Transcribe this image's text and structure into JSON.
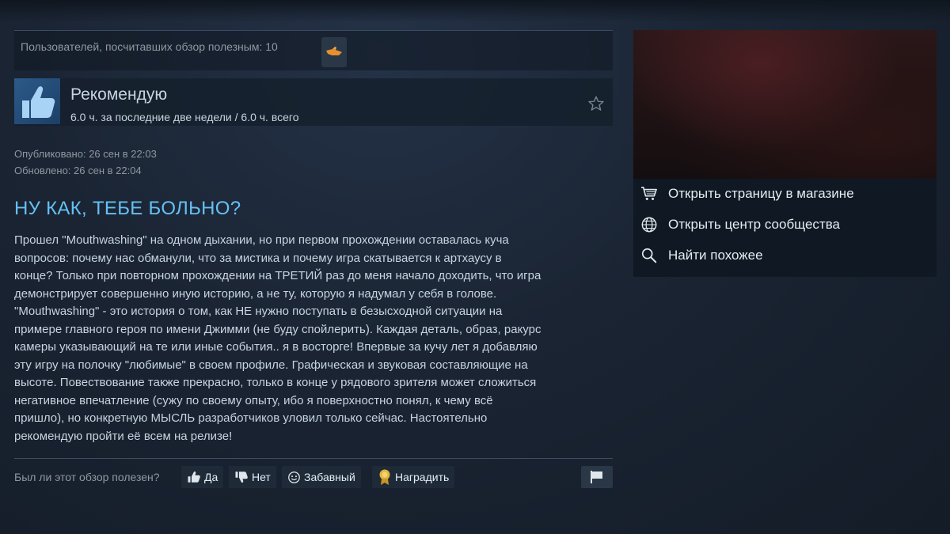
{
  "helpful": {
    "text": "Пользователей, посчитавших обзор полезным: 10"
  },
  "recommendation": {
    "label": "Рекомендую",
    "hours": "6.0 ч. за последние две недели / 6.0 ч. всего"
  },
  "dates": {
    "published": "Опубликовано: 26 сен в 22:03",
    "updated": "Обновлено: 26 сен в 22:04"
  },
  "review": {
    "title": "НУ КАК, ТЕБЕ БОЛЬНО?",
    "lines": [
      "Прошел \"Mouthwashing\" на одном дыхании, но при первом прохождении оставалась куча",
      "вопросов: почему нас обманули, что за мистика и почему игра скатывается к артхаусу в",
      "конце? Только при повторном прохождении на ТРЕТИЙ раз до меня начало доходить, что игра",
      "демонстрирует совершенно иную историю, а не ту, которую я надумал у себя в голове.",
      "\"Mouthwashing\" - это история о том, как НЕ нужно поступать в безысходной ситуации на",
      "примере главного героя по имени Джимми (не буду спойлерить). Каждая деталь, образ, ракурс",
      "камеры указывающий на те или иные события.. я в восторге! Впервые за кучу лет я добавляю",
      "эту игру на полочку \"любимые\" в своем профиле. Графическая и звуковая составляющие на",
      "высоте. Повествование также прекрасно, только в конце у рядового зрителя может сложиться",
      "негативное впечатление (сужу по своему опыту, ибо я поверхностно понял, к чему всё",
      "пришло), но конкретную МЫСЛЬ разработчиков уловил только сейчас. Настоятельно",
      "рекомендую пройти её всем на релизе!"
    ]
  },
  "voting": {
    "question": "Был ли этот обзор полезен?",
    "yes": "Да",
    "no": "Нет",
    "funny": "Забавный",
    "award": "Наградить"
  },
  "sidebar": {
    "links": [
      {
        "label": "Открыть страницу в магазине",
        "icon": "cart-icon"
      },
      {
        "label": "Открыть центр сообщества",
        "icon": "globe-icon"
      },
      {
        "label": "Найти похожее",
        "icon": "search-icon"
      }
    ]
  },
  "colors": {
    "background": "#1b2838",
    "accent": "#66c0f4",
    "text": "#c6d4df",
    "muted": "#8f98a0"
  }
}
